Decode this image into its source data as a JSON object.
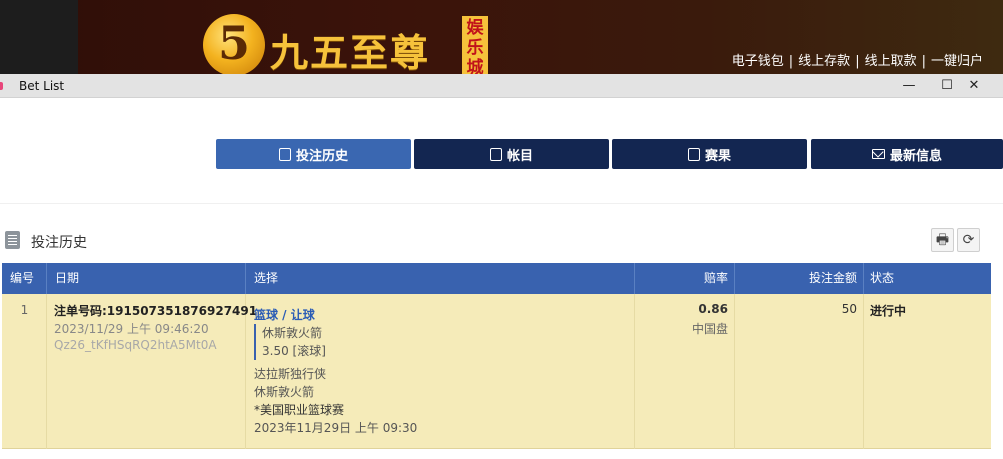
{
  "banner": {
    "logo_numeral": "5",
    "logo_text": "九五至尊",
    "logo_sub": "娱乐城",
    "links": [
      "电子钱包",
      "线上存款",
      "线上取款",
      "一键归户"
    ],
    "separator": "|"
  },
  "window": {
    "title": "Bet List",
    "minimize": "—",
    "maximize": "☐",
    "close": "✕"
  },
  "nav": {
    "items": [
      {
        "label": "投注历史",
        "active": true
      },
      {
        "label": "帐目",
        "active": false
      },
      {
        "label": "赛果",
        "active": false
      },
      {
        "label": "最新信息",
        "active": false
      }
    ]
  },
  "section": {
    "title": "投注历史",
    "print_icon": "🖶",
    "refresh_icon": "⟳"
  },
  "table": {
    "headers": {
      "no": "编号",
      "date": "日期",
      "selection": "选择",
      "odds": "赔率",
      "stake": "投注金额",
      "status": "状态"
    },
    "rows": [
      {
        "no": "1",
        "ticket": "注单号码:191507351876927491",
        "datetime": "2023/11/29 上午 09:46:20",
        "code": "Qz26_tKfHSqRQ2htA5Mt0A",
        "sport": "篮球 / 让球",
        "pick": "休斯敦火箭",
        "line": "3.50 [滚球]",
        "home": "达拉斯独行侠",
        "away": "休斯敦火箭",
        "league": "*美国职业篮球赛",
        "match_time": "2023年11月29日 上午 09:30",
        "odds": "0.86",
        "odds_type": "中国盘",
        "stake": "50",
        "status": "进行中"
      }
    ]
  },
  "colors": {
    "nav_active": "#3a67b1",
    "nav_dark": "#132651",
    "table_header": "#3962af",
    "row_bg": "#f5ebb9",
    "link_blue": "#2a5bb5"
  }
}
